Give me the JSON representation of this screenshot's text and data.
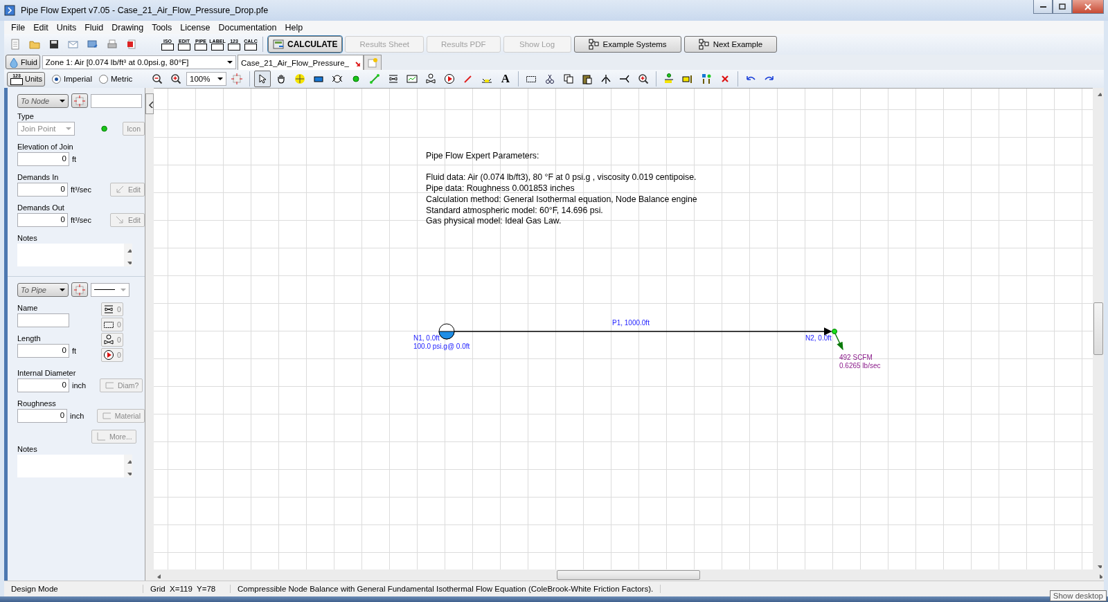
{
  "window": {
    "title": "Pipe Flow Expert v7.05 - Case_21_Air_Flow_Pressure_Drop.pfe"
  },
  "menu": [
    "File",
    "Edit",
    "Units",
    "Fluid",
    "Drawing",
    "Tools",
    "License",
    "Documentation",
    "Help"
  ],
  "toolbar": {
    "label_icons": [
      "ISO",
      "EDIT",
      "PIPE",
      "LABEL",
      "123",
      "CALC"
    ],
    "buttons": [
      {
        "label": "CALCULATE",
        "kind": "calculate",
        "disabled": false
      },
      {
        "label": "Results Sheet",
        "kind": "plain",
        "disabled": true
      },
      {
        "label": "Results PDF",
        "kind": "plain",
        "disabled": true
      },
      {
        "label": "Show Log",
        "kind": "plain",
        "disabled": true
      },
      {
        "label": "Example Systems",
        "kind": "examples",
        "disabled": false
      },
      {
        "label": "Next Example",
        "kind": "next",
        "disabled": false
      }
    ]
  },
  "fluid": {
    "button": "Fluid",
    "zone": "Zone 1: Air [0.074 lb/ft³ at 0.0psi.g, 80°F]"
  },
  "document_tabs": [
    {
      "label": "Case_21_Air_Flow_Pressure_",
      "selected": true
    }
  ],
  "units": {
    "button": "Units",
    "icon_text": "123",
    "options": [
      {
        "label": "Imperial",
        "selected": true
      },
      {
        "label": "Metric",
        "selected": false
      }
    ]
  },
  "drawing_toolbar": {
    "zoom": "100%",
    "text_tool": "A"
  },
  "node_panel": {
    "selector": "To Node",
    "type_label": "Type",
    "type": "Join Point",
    "icon_button": "Icon",
    "fields": [
      {
        "label": "Elevation of Join",
        "value": "0",
        "unit": "ft"
      },
      {
        "label": "Demands In",
        "value": "0",
        "unit": "ft³/sec",
        "button": "Edit"
      },
      {
        "label": "Demands Out",
        "value": "0",
        "unit": "ft³/sec",
        "button": "Edit"
      }
    ],
    "notes_label": "Notes"
  },
  "pipe_panel": {
    "selector": "To Pipe",
    "name_label": "Name",
    "counts": [
      "0",
      "0",
      "0",
      "0"
    ],
    "fields": [
      {
        "label": "Length",
        "value": "0",
        "unit": "ft"
      },
      {
        "label": "Internal Diameter",
        "value": "0",
        "unit": "inch",
        "button": "Diam?"
      },
      {
        "label": "Roughness",
        "value": "0",
        "unit": "inch",
        "button": "Material"
      }
    ],
    "more_button": "More...",
    "notes_label": "Notes"
  },
  "canvas": {
    "notes_title": "Pipe Flow Expert Parameters:",
    "notes": [
      "Fluid data: Air (0.074 lb/ft3), 80 °F at 0 psi.g , viscosity 0.019 centipoise.",
      "Pipe data: Roughness 0.001853 inches",
      "Calculation method: General Isothermal equation, Node Balance engine",
      "Standard atmospheric model: 60°F, 14.696 psi.",
      "Gas physical model: Ideal Gas Law."
    ],
    "pipe_label": "P1, 1000.0ft",
    "nodes": [
      {
        "kind": "tank",
        "labels": [
          "N1, 0.0ft",
          "100.0 psi.g@ 0.0ft"
        ]
      },
      {
        "kind": "join",
        "labels": [
          "N2, 0.0ft"
        ],
        "demand": [
          "492 SCFM",
          "0.6265 lb/sec"
        ]
      }
    ]
  },
  "status_bar": {
    "mode": "Design Mode",
    "grid": "Grid  X=119  Y=78",
    "message": "Compressible Node Balance with General Fundamental Isothermal Flow Equation (ColeBrook-White Friction Factors)."
  },
  "tooltip": "Show desktop"
}
